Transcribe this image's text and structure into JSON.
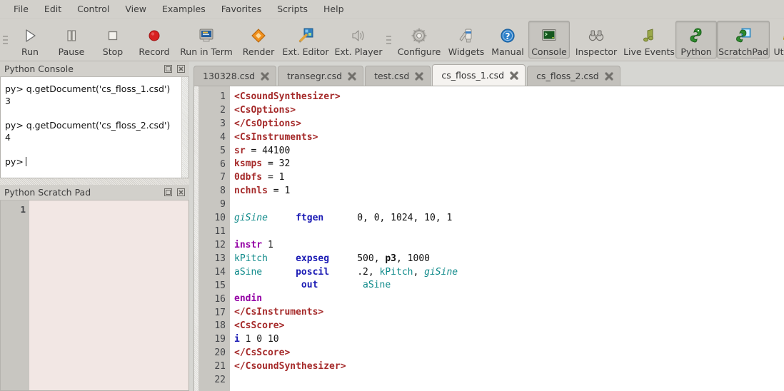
{
  "menu": {
    "items": [
      {
        "label": "File"
      },
      {
        "label": "Edit"
      },
      {
        "label": "Control"
      },
      {
        "label": "View"
      },
      {
        "label": "Examples"
      },
      {
        "label": "Favorites"
      },
      {
        "label": "Scripts"
      },
      {
        "label": "Help"
      }
    ]
  },
  "toolbar": {
    "groups": [
      {
        "buttons": [
          {
            "label": "Run",
            "icon": "play-icon",
            "pressed": false,
            "width": "normal"
          },
          {
            "label": "Pause",
            "icon": "pause-icon",
            "pressed": false,
            "width": "normal"
          },
          {
            "label": "Stop",
            "icon": "stop-icon",
            "pressed": false,
            "width": "normal"
          },
          {
            "label": "Record",
            "icon": "record-icon",
            "pressed": false,
            "width": "normal"
          },
          {
            "label": "Run in Term",
            "icon": "terminal-run-icon",
            "pressed": false,
            "width": "wide"
          },
          {
            "label": "Render",
            "icon": "render-diamond-icon",
            "pressed": false,
            "width": "normal"
          },
          {
            "label": "Ext. Editor",
            "icon": "magic-wand-icon",
            "pressed": false,
            "width": "wide2"
          },
          {
            "label": "Ext. Player",
            "icon": "speaker-icon",
            "pressed": false,
            "width": "wide2"
          }
        ]
      },
      {
        "buttons": [
          {
            "label": "Configure",
            "icon": "gear-icon",
            "pressed": false,
            "width": "wide2"
          },
          {
            "label": "Widgets",
            "icon": "paintbrush-icon",
            "pressed": false,
            "width": "normal"
          },
          {
            "label": "Manual",
            "icon": "help-circle-icon",
            "pressed": false,
            "width": "normal"
          },
          {
            "label": "Console",
            "icon": "console-icon",
            "pressed": true,
            "width": "normal"
          },
          {
            "label": "Inspector",
            "icon": "binoculars-icon",
            "pressed": false,
            "width": "wide2"
          },
          {
            "label": "Live Events",
            "icon": "music-note-icon",
            "pressed": false,
            "width": "wide2"
          },
          {
            "label": "Python",
            "icon": "python-snake-icon",
            "pressed": true,
            "width": "normal"
          },
          {
            "label": "ScratchPad",
            "icon": "python-pad-icon",
            "pressed": true,
            "width": "wide2"
          },
          {
            "label": "Utilities",
            "icon": "hardhat-icon",
            "pressed": false,
            "width": "normal"
          }
        ]
      }
    ]
  },
  "python_console": {
    "title": "Python Console",
    "float_label": "float",
    "close_label": "close",
    "lines": [
      "py> q.getDocument('cs_floss_1.csd')",
      "3",
      "",
      "py> q.getDocument('cs_floss_2.csd')",
      "4",
      ""
    ],
    "prompt": "py>"
  },
  "python_scratch_pad": {
    "title": "Python Scratch Pad",
    "line_numbers": [
      "1"
    ],
    "content": ""
  },
  "tabs": [
    {
      "label": "130328.csd",
      "active": false
    },
    {
      "label": "transegr.csd",
      "active": false
    },
    {
      "label": "test.csd",
      "active": false
    },
    {
      "label": "cs_floss_1.csd",
      "active": true
    },
    {
      "label": "cs_floss_2.csd",
      "active": false
    }
  ],
  "editor": {
    "line_numbers": [
      "1",
      "2",
      "3",
      "4",
      "5",
      "6",
      "7",
      "8",
      "9",
      "10",
      "11",
      "12",
      "13",
      "14",
      "15",
      "16",
      "17",
      "18",
      "19",
      "20",
      "21",
      "22"
    ],
    "lines": [
      {
        "n": 1,
        "tokens": [
          {
            "t": "<CsoundSynthesizer>",
            "c": "tag"
          }
        ]
      },
      {
        "n": 2,
        "tokens": [
          {
            "t": "<CsOptions>",
            "c": "tag"
          }
        ]
      },
      {
        "n": 3,
        "tokens": [
          {
            "t": "</CsOptions>",
            "c": "tag"
          }
        ]
      },
      {
        "n": 4,
        "tokens": [
          {
            "t": "<CsInstruments>",
            "c": "tag"
          }
        ]
      },
      {
        "n": 5,
        "tokens": [
          {
            "t": "sr",
            "c": "hdr"
          },
          {
            "t": " = ",
            "c": "num"
          },
          {
            "t": "44100",
            "c": "num"
          }
        ]
      },
      {
        "n": 6,
        "tokens": [
          {
            "t": "ksmps",
            "c": "hdr"
          },
          {
            "t": " = ",
            "c": "num"
          },
          {
            "t": "32",
            "c": "num"
          }
        ]
      },
      {
        "n": 7,
        "tokens": [
          {
            "t": "0dbfs",
            "c": "hdr"
          },
          {
            "t": " = ",
            "c": "num"
          },
          {
            "t": "1",
            "c": "num"
          }
        ]
      },
      {
        "n": 8,
        "tokens": [
          {
            "t": "nchnls",
            "c": "hdr"
          },
          {
            "t": " = ",
            "c": "num"
          },
          {
            "t": "1",
            "c": "num"
          }
        ]
      },
      {
        "n": 9,
        "tokens": []
      },
      {
        "n": 10,
        "tokens": [
          {
            "t": "giSine",
            "c": "gvar"
          },
          {
            "t": "     ",
            "c": "num"
          },
          {
            "t": "ftgen",
            "c": "op"
          },
          {
            "t": "      ",
            "c": "num"
          },
          {
            "t": "0, 0, 1024, 10, 1",
            "c": "num"
          }
        ]
      },
      {
        "n": 11,
        "tokens": []
      },
      {
        "n": 12,
        "tokens": [
          {
            "t": "instr",
            "c": "kw"
          },
          {
            "t": " 1",
            "c": "num"
          }
        ]
      },
      {
        "n": 13,
        "tokens": [
          {
            "t": "kPitch",
            "c": "var"
          },
          {
            "t": "     ",
            "c": "num"
          },
          {
            "t": "expseg",
            "c": "op"
          },
          {
            "t": "     ",
            "c": "num"
          },
          {
            "t": "500, ",
            "c": "num"
          },
          {
            "t": "p3",
            "c": "pfield"
          },
          {
            "t": ", 1000",
            "c": "num"
          }
        ]
      },
      {
        "n": 14,
        "tokens": [
          {
            "t": "aSine",
            "c": "var"
          },
          {
            "t": "      ",
            "c": "num"
          },
          {
            "t": "poscil",
            "c": "op"
          },
          {
            "t": "     ",
            "c": "num"
          },
          {
            "t": ".2, ",
            "c": "num"
          },
          {
            "t": "kPitch",
            "c": "var"
          },
          {
            "t": ", ",
            "c": "num"
          },
          {
            "t": "giSine",
            "c": "gvar"
          }
        ]
      },
      {
        "n": 15,
        "tokens": [
          {
            "t": "            ",
            "c": "num"
          },
          {
            "t": "out",
            "c": "op"
          },
          {
            "t": "        ",
            "c": "num"
          },
          {
            "t": "aSine",
            "c": "var"
          }
        ]
      },
      {
        "n": 16,
        "tokens": [
          {
            "t": "endin",
            "c": "kw"
          }
        ]
      },
      {
        "n": 17,
        "tokens": [
          {
            "t": "</CsInstruments>",
            "c": "tag"
          }
        ]
      },
      {
        "n": 18,
        "tokens": [
          {
            "t": "<CsScore>",
            "c": "tag"
          }
        ]
      },
      {
        "n": 19,
        "tokens": [
          {
            "t": "i",
            "c": "i"
          },
          {
            "t": " 1 0 10",
            "c": "num"
          }
        ]
      },
      {
        "n": 20,
        "tokens": [
          {
            "t": "</CsScore>",
            "c": "tag"
          }
        ]
      },
      {
        "n": 21,
        "tokens": [
          {
            "t": "</CsoundSynthesizer>",
            "c": "tag"
          }
        ]
      },
      {
        "n": 22,
        "tokens": []
      }
    ]
  },
  "colors": {
    "toolbar_bg": "#d2d0cb",
    "window_bg": "#d6d6d2",
    "editor_bg": "#ffffff",
    "gutter_bg": "#c8c6c1",
    "scratch_bg": "#f2e7e4",
    "tag": "#a52a2a",
    "opcode": "#1a1ab4",
    "keyword": "#9400a5",
    "variable": "#0f8a8a",
    "active_tab": "#f5f3f0"
  }
}
